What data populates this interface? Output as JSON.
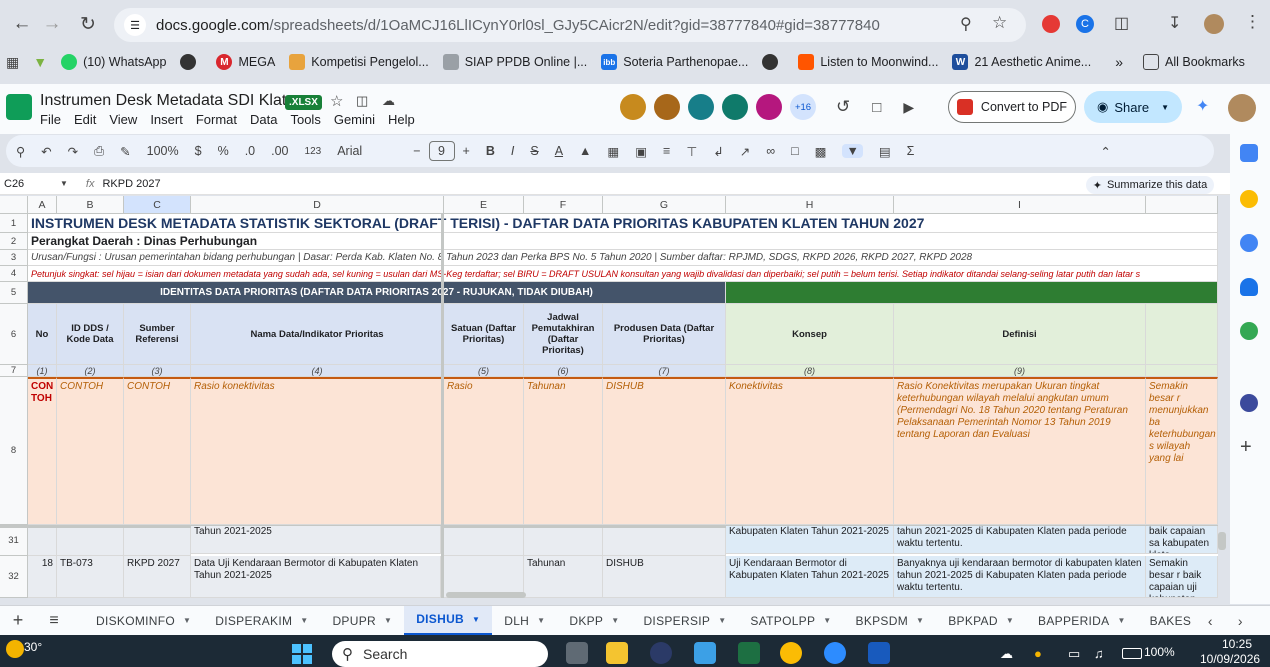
{
  "browser": {
    "url_host": "docs.google.com",
    "url_path": "/spreadsheets/d/1OaMCJ16LlICynY0rl0sl_GJy5CAicr2N/edit?gid=38777840#gid=38777840",
    "bookmarks": [
      {
        "label": "(10) WhatsApp",
        "color": "#25d366"
      },
      {
        "label": "MEGA",
        "color": "#d9272e"
      },
      {
        "label": "Kompetisi Pengelol...",
        "color": "#e8a33d"
      },
      {
        "label": "SIAP PPDB Online |...",
        "color": "#9aa0a6"
      },
      {
        "label": "Soteria Parthenopae...",
        "color": "#1a73e8"
      },
      {
        "label": "Listen to Moonwind...",
        "color": "#ff5500"
      },
      {
        "label": "21 Aesthetic Anime...",
        "color": "#1e4e9c"
      }
    ],
    "all_bookmarks": "All Bookmarks"
  },
  "doc": {
    "title": "Instrumen Desk Metadata SDI Klaten",
    "badge": ".XLSX",
    "menu": [
      "File",
      "Edit",
      "View",
      "Insert",
      "Format",
      "Data",
      "Tools",
      "Gemini",
      "Help"
    ],
    "collab_more": "+16",
    "convert_label": "Convert to PDF",
    "share_label": "Share"
  },
  "toolbar": {
    "zoom": "100%",
    "currency": "$",
    "percent": "%",
    "dec_less": ".0",
    "dec_more": ".00",
    "format_123": "123",
    "font": "Arial",
    "font_size": "9"
  },
  "formula": {
    "cell_ref": "C26",
    "fx": "fx",
    "content": "RKPD 2027",
    "summarize": "Summarize this data"
  },
  "columns": [
    "A",
    "B",
    "C",
    "D",
    "E",
    "F",
    "G",
    "H",
    "I"
  ],
  "rows": {
    "r1": "INSTRUMEN DESK METADATA STATISTIK SEKTORAL (DRAFT TERISI) - DAFTAR DATA PRIORITAS KABUPATEN KLATEN TAHUN 2027",
    "r2": "Perangkat Daerah : Dinas Perhubungan",
    "r3": "Urusan/Fungsi : Urusan pemerintahan bidang perhubungan  |  Dasar: Perda Kab. Klaten No. 8 Tahun 2023 dan Perka BPS No. 5 Tahun 2020  |  Sumber daftar: RPJMD, SDGS, RKPD 2026, RKPD 2027, RKPD 2028",
    "r4": "Petunjuk singkat: sel hijau = isian dari dokumen metadata yang sudah ada, sel kuning = usulan dari MS-Keg terdaftar; sel BIRU = DRAFT USULAN konsultan yang wajib divalidasi dan diperbaiki; sel putih = belum terisi. Setiap indikator ditandai selang-seling latar putih dan latar s",
    "r5_left": "IDENTITAS DATA PRIORITAS (DAFTAR DATA PRIORITAS 2027 - RUJUKAN, TIDAK DIUBAH)",
    "r6": [
      "No",
      "ID DDS / Kode Data",
      "Sumber Referensi",
      "Nama Data/Indikator Prioritas",
      "Satuan (Daftar Prioritas)",
      "Jadwal Pemutakhiran (Daftar Prioritas)",
      "Produsen Data (Daftar Prioritas)",
      "Konsep",
      "Definisi"
    ],
    "r7": [
      "(1)",
      "(2)",
      "(3)",
      "(4)",
      "(5)",
      "(6)",
      "(7)",
      "(8)",
      "(9)"
    ],
    "r8": {
      "a": "CON TOH",
      "b": "CONTOH",
      "c": "CONTOH",
      "d": "Rasio konektivitas",
      "e": "Rasio",
      "f": "Tahunan",
      "g": "DISHUB",
      "h": "Konektivitas",
      "i": "Rasio Konektivitas merupakan Ukuran tingkat keterhubungan wilayah melalui angkutan umum (Permendagri No. 18 Tahun 2020 tentang Peraturan Pelaksanaan Pemerintah Nomor 13 Tahun 2019 tentang Laporan dan Evaluasi",
      "j": "Semakin besar r menunjukkan ba keterhubungan s wilayah yang lai"
    },
    "r31": {
      "d": "Tahun 2021-2025",
      "h": "Kabupaten Klaten Tahun 2021-2025",
      "i": "tahun 2021-2025 di Kabupaten Klaten pada periode waktu tertentu.",
      "j": "baik capaian sa kabupaten klate Kabupaten Klat"
    },
    "r32": {
      "a": "18",
      "b": "TB-073",
      "c": "RKPD 2027",
      "d": "Data Uji Kendaraan Bermotor di Kabupaten Klaten Tahun 2021-2025",
      "f": "Tahunan",
      "g": "DISHUB",
      "h": "Uji Kendaraan Bermotor di Kabupaten Klaten Tahun 2021-2025",
      "i": "Banyaknya uji kendaraan bermotor di kabupaten klaten tahun 2021-2025 di Kabupaten Klaten pada periode waktu tertentu.",
      "j": "Semakin besar r baik capaian uji kabupaten klate"
    },
    "row_numbers": [
      "1",
      "2",
      "3",
      "4",
      "5",
      "6",
      "7",
      "8",
      "31",
      "32"
    ]
  },
  "tabs": [
    "DISKOMINFO",
    "DISPERAKIM",
    "DPUPR",
    "DISHUB",
    "DLH",
    "DKPP",
    "DISPERSIP",
    "SATPOLPP",
    "BKPSDM",
    "BPKPAD",
    "BAPPERIDA",
    "BAKES"
  ],
  "active_tab": "DISHUB",
  "taskbar": {
    "temp": "30°",
    "search": "Search",
    "battery": "100%",
    "time": "10:25",
    "date": "10/09/2026"
  }
}
